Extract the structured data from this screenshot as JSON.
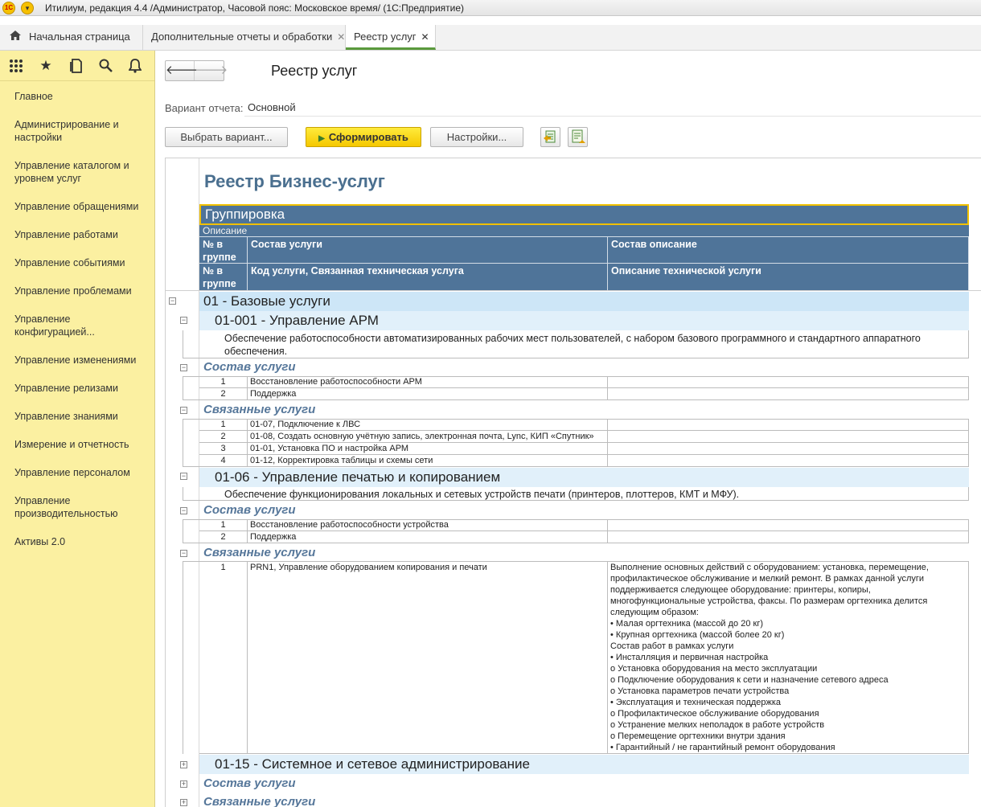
{
  "titlebar": {
    "logo": "1С",
    "text": "Итилиум, редакция 4.4 /Администратор, Часовой пояс: Московское время/  (1С:Предприятие)"
  },
  "tabs": [
    {
      "label": "Начальная страница"
    },
    {
      "label": "Дополнительные отчеты и обработки"
    },
    {
      "label": "Реестр услуг"
    }
  ],
  "sidebar": {
    "icons": [
      "apps-grid-icon",
      "star-icon",
      "history-icon",
      "search-icon",
      "bell-icon"
    ],
    "items": [
      "Главное",
      "Администрирование и настройки",
      "Управление каталогом и уровнем услуг",
      "Управление обращениями",
      "Управление работами",
      "Управление событиями",
      "Управление проблемами",
      "Управление конфигурацией...",
      "Управление изменениями",
      "Управление релизами",
      "Управление знаниями",
      "Измерение и отчетность",
      "Управление персоналом",
      "Управление производительностью",
      "Активы 2.0"
    ]
  },
  "page": {
    "title": "Реестр услуг",
    "variant_label": "Вариант отчета:",
    "variant_value": "Основной"
  },
  "toolbar": {
    "select_variant": "Выбрать вариант...",
    "generate": "Сформировать",
    "settings": "Настройки..."
  },
  "report": {
    "title": "Реестр Бизнес-услуг",
    "header": {
      "grouping": "Группировка",
      "description": "Описание",
      "num_in_group": "№ в группе",
      "service_composition": "Состав услуги",
      "composition_description": "Состав описание",
      "service_code": "Код услуги, Связанная техническая услуга",
      "tech_description": "Описание технической услуги"
    },
    "section_composition": "Состав услуги",
    "section_related": "Связанные услуги",
    "group1": "01 - Базовые услуги",
    "svc1": {
      "name": "01-001 - Управление АРМ",
      "description": "Обеспечение работоспособности автоматизированных рабочих мест пользователей, с набором базового программного и стандартного аппаратного обеспечения.",
      "composition": [
        {
          "n": "1",
          "text": "Восстановление работоспособности АРМ"
        },
        {
          "n": "2",
          "text": "Поддержка"
        }
      ],
      "related": [
        {
          "n": "1",
          "text": "01-07, Подключение к ЛВС"
        },
        {
          "n": "2",
          "text": "01-08, Создать основную учётную запись, электронная почта, Lync, КИП «Спутник»"
        },
        {
          "n": "3",
          "text": "01-01, Установка ПО и настройка АРМ"
        },
        {
          "n": "4",
          "text": "01-12, Корректировка таблицы и схемы сети"
        }
      ]
    },
    "svc2": {
      "name": "01-06 - Управление печатью и копированием",
      "description": "Обеспечение функционирования локальных и сетевых устройств печати (принтеров, плоттеров, КМТ и МФУ).",
      "composition": [
        {
          "n": "1",
          "text": "Восстановление работоспособности устройства"
        },
        {
          "n": "2",
          "text": "Поддержка"
        }
      ],
      "related": [
        {
          "n": "1",
          "text": "PRN1, Управление оборудованием копирования и печати"
        }
      ],
      "related_description": "Выполнение основных действий с оборудованием: установка, перемещение, профилактическое обслуживание и мелкий ремонт. В рамках данной услуги поддерживается следующее оборудование: принтеры, копиры, многофункциональные устройства, факсы. По размерам оргтехника делится следующим образом:\n• Малая оргтехника (массой до 20 кг)\n• Крупная оргтехника (массой более 20 кг)\nСостав работ в рамках услуги\n• Инсталляция и первичная настройка\no Установка оборудования на место эксплуатации\no Подключение оборудования к сети и назначение сетевого адреса\no Установка параметров печати устройства\n• Эксплуатация и техническая поддержка\no Профилактическое обслуживание оборудования\no Устранение мелких неполадок в работе устройств\no Перемещение оргтехники внутри здания\n• Гарантийный / не гарантийный ремонт оборудования"
    },
    "svc3": {
      "name": "01-15 - Системное и сетевое администрирование"
    }
  }
}
